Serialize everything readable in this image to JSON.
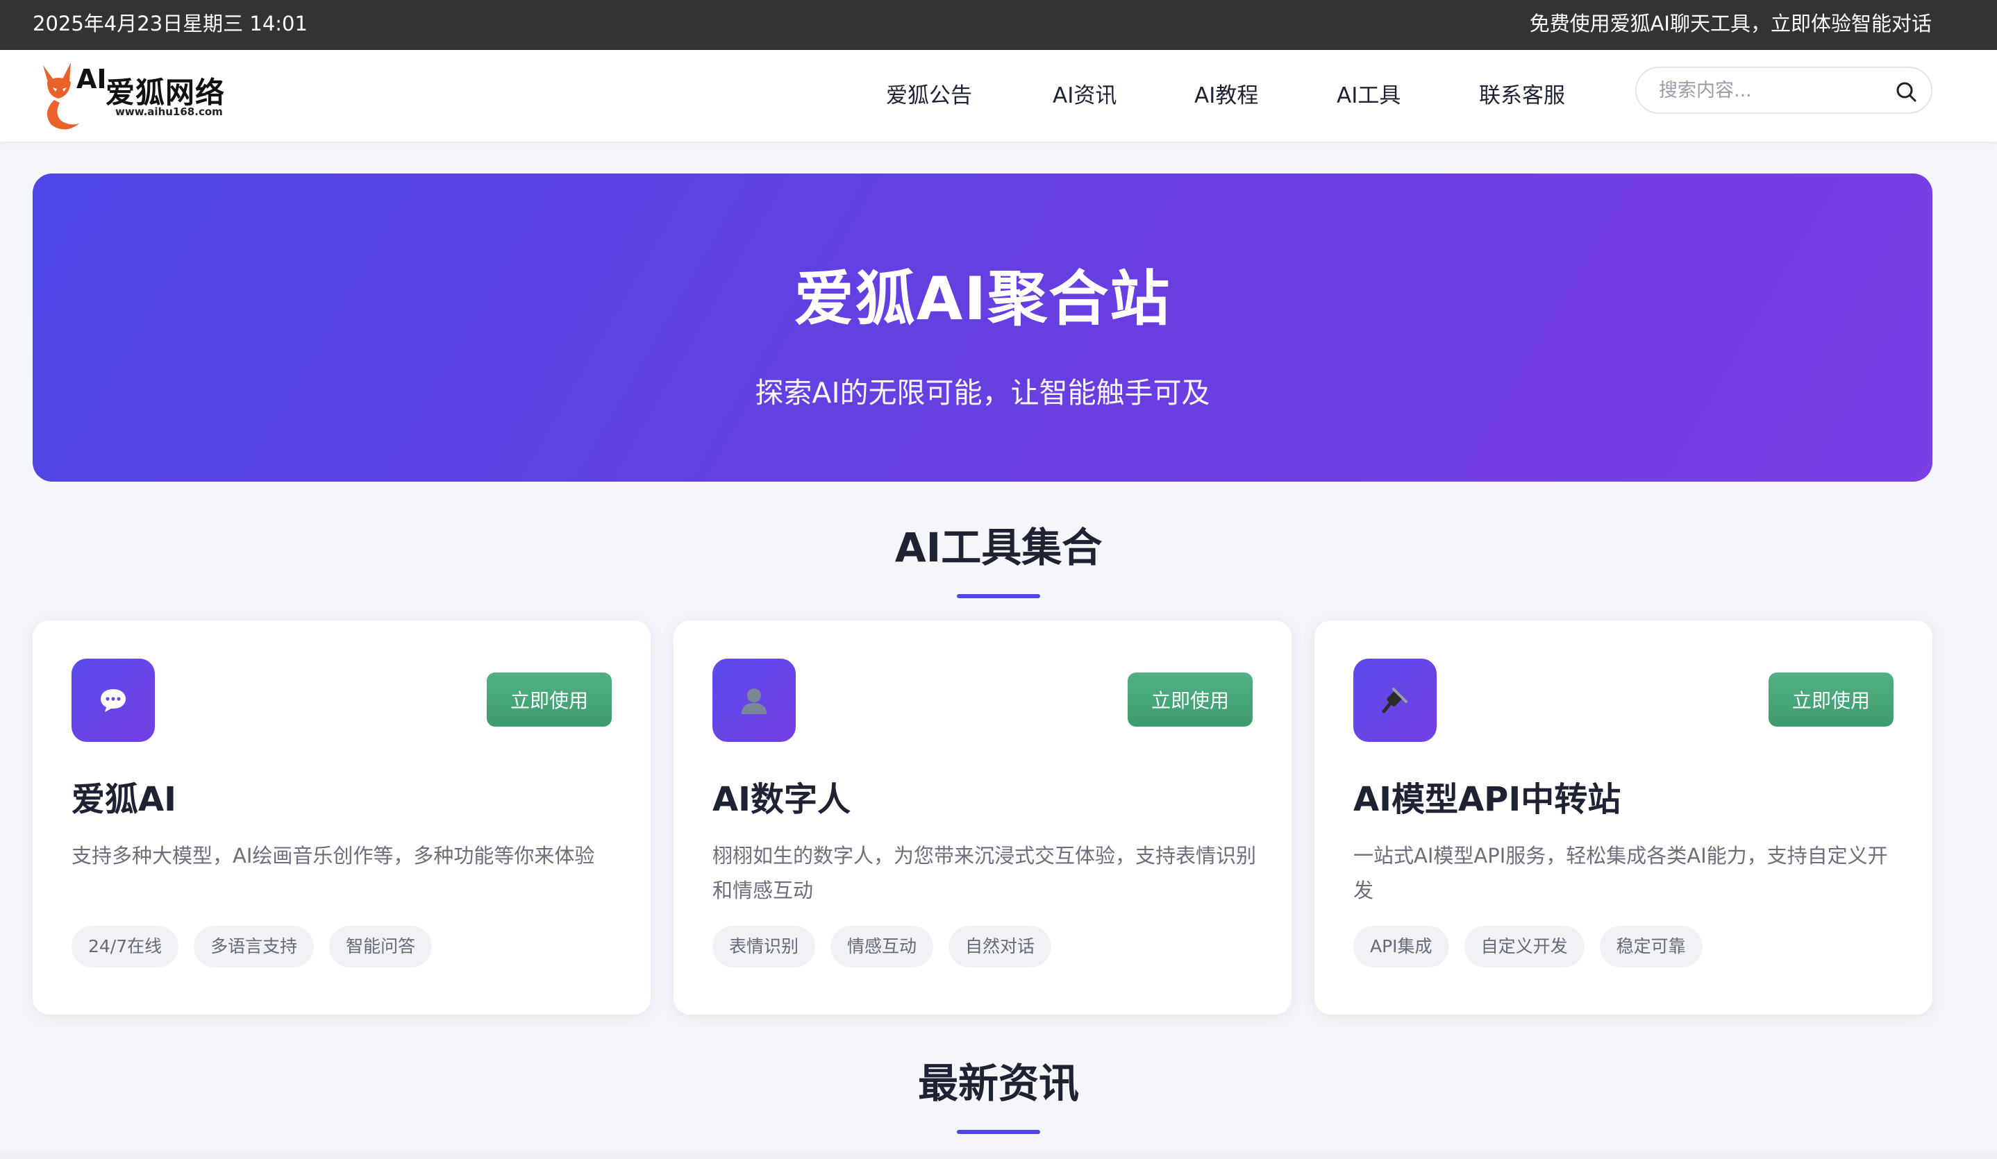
{
  "topbar": {
    "datetime": "2025年4月23日星期三 14:01",
    "promo": "免费使用爱狐AI聊天工具，立即体验智能对话"
  },
  "header": {
    "logo": {
      "mark": "AI",
      "name": "爱狐网络",
      "domain": "www.aihu168.com"
    },
    "nav": [
      {
        "label": "爱狐公告"
      },
      {
        "label": "AI资讯"
      },
      {
        "label": "AI教程"
      },
      {
        "label": "AI工具"
      },
      {
        "label": "联系客服"
      }
    ],
    "search": {
      "placeholder": "搜索内容...",
      "value": "",
      "icon": "search-icon"
    }
  },
  "hero": {
    "title": "爱狐AI聚合站",
    "subtitle": "探索AI的无限可能，让智能触手可及"
  },
  "tools_section": {
    "title": "AI工具集合",
    "accent_color": "#4f46e5",
    "cards": [
      {
        "icon": "chat-bubble-icon",
        "name": "爱狐AI",
        "button": "立即使用",
        "description": "支持多种大模型，AI绘画音乐创作等，多种功能等你来体验",
        "tags": [
          "24/7在线",
          "多语言支持",
          "智能问答"
        ]
      },
      {
        "icon": "person-icon",
        "name": "AI数字人",
        "button": "立即使用",
        "description": "栩栩如生的数字人，为您带来沉浸式交互体验，支持表情识别和情感互动",
        "tags": [
          "表情识别",
          "情感互动",
          "自然对话"
        ]
      },
      {
        "icon": "plug-icon",
        "name": "AI模型API中转站",
        "button": "立即使用",
        "description": "一站式AI模型API服务，轻松集成各类AI能力，支持自定义开发",
        "tags": [
          "API集成",
          "自定义开发",
          "稳定可靠"
        ]
      }
    ]
  },
  "news_section": {
    "title": "最新资讯"
  },
  "colors": {
    "topbar": "#333333",
    "hero_start": "#4f46e5",
    "hero_end": "#7b3fe4",
    "button": "#45a578",
    "logo_orange": "#e8622a"
  }
}
